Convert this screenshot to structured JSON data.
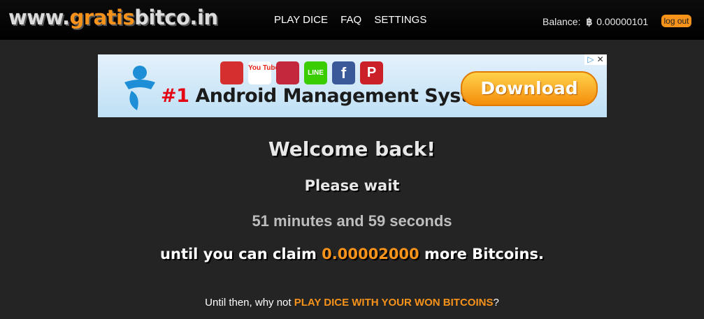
{
  "header": {
    "logo_part1": "www.",
    "logo_part2": "gratis",
    "logo_part3": "bitco.in",
    "nav": [
      "PLAY DICE",
      "FAQ",
      "SETTINGS"
    ],
    "balance_label": "Balance:",
    "balance_symbol": "฿",
    "balance_value": "0.00000101",
    "logout_label": "log out"
  },
  "ad": {
    "apps": [
      "",
      "You Tube",
      "",
      "LINE",
      "f",
      "P"
    ],
    "headline_number": "#1",
    "headline_text": " Android Management System",
    "button_label": "Download",
    "adchoices_icon": "adchoices-icon",
    "close_glyph": "✕"
  },
  "main": {
    "welcome": "Welcome back!",
    "please_wait": "Please wait",
    "timer": "51 minutes and 59 seconds",
    "claim_prefix": "until you can claim ",
    "claim_amount": "0.00002000",
    "claim_suffix": " more Bitcoins.",
    "until_prefix": "Until then, why not ",
    "until_link": "PLAY DICE WITH YOUR WON BITCOINS",
    "until_suffix": "?"
  },
  "colors": {
    "background": "#242424",
    "accent": "#f7931a",
    "header": "#000000"
  }
}
